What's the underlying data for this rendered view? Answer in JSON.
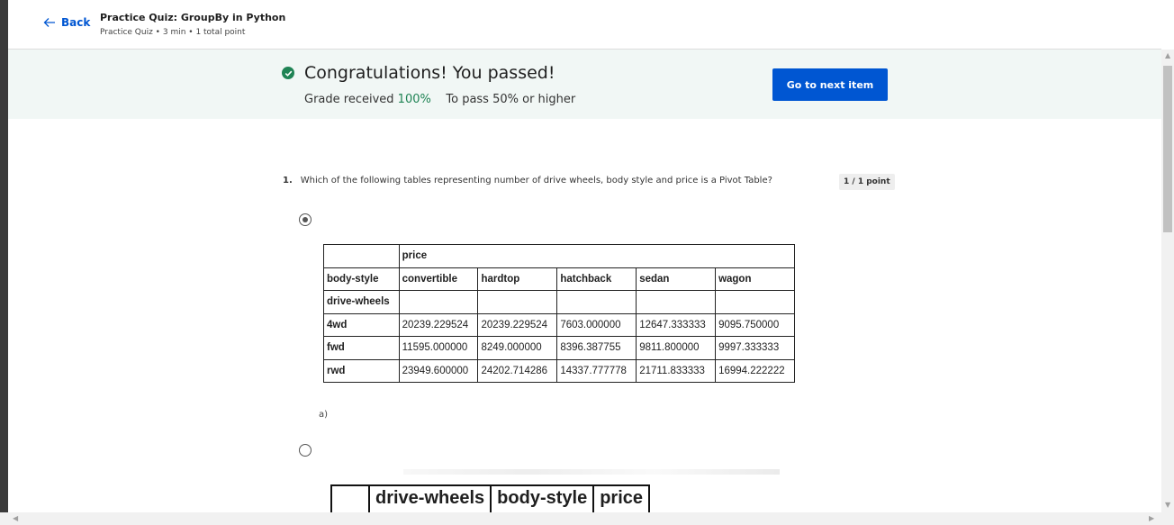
{
  "header": {
    "back_label": "Back",
    "title": "Practice Quiz: GroupBy in Python",
    "meta": "Practice Quiz • 3 min • 1 total point"
  },
  "banner": {
    "title": "Congratulations! You passed!",
    "grade_label": "Grade received",
    "grade_value": "100%",
    "pass_label": "To pass 50% or higher",
    "next_button": "Go to next item"
  },
  "question": {
    "number": "1.",
    "text": "Which of the following tables representing number of drive wheels, body style and price is a Pivot Table?",
    "points": "1 / 1 point"
  },
  "option_a": {
    "label": "a)",
    "selected": true,
    "table": {
      "top_header": "price",
      "col_index_name": "body-style",
      "row_index_name": "drive-wheels",
      "columns": [
        "convertible",
        "hardtop",
        "hatchback",
        "sedan",
        "wagon"
      ],
      "rows": [
        {
          "key": "4wd",
          "values": [
            "20239.229524",
            "20239.229524",
            "7603.000000",
            "12647.333333",
            "9095.750000"
          ]
        },
        {
          "key": "fwd",
          "values": [
            "11595.000000",
            "8249.000000",
            "8396.387755",
            "9811.800000",
            "9997.333333"
          ]
        },
        {
          "key": "rwd",
          "values": [
            "23949.600000",
            "24202.714286",
            "14337.777778",
            "21711.833333",
            "16994.222222"
          ]
        }
      ]
    }
  },
  "option_b": {
    "selected": false,
    "headers": [
      "drive-wheels",
      "body-style",
      "price"
    ]
  },
  "colors": {
    "accent": "#0056d2",
    "success": "#1f8354",
    "banner_bg": "#f1f7f5"
  }
}
